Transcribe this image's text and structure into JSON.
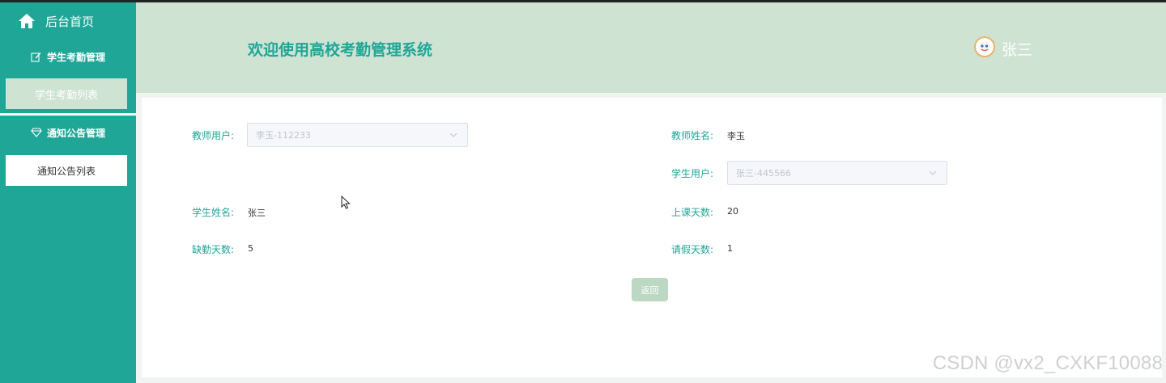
{
  "sidebar": {
    "home_label": "后台首页",
    "groups": [
      {
        "label": "学生考勤管理",
        "icon": "edit-icon"
      },
      {
        "label": "通知公告管理",
        "icon": "diamond-icon"
      }
    ],
    "items": [
      {
        "label": "学生考勤列表",
        "active": true
      },
      {
        "label": "通知公告列表",
        "active": false
      }
    ]
  },
  "header": {
    "title": "欢迎使用高校考勤管理系统",
    "username": "张三"
  },
  "form": {
    "teacher_user": {
      "label": "教师用户:",
      "value": "李玉-112233"
    },
    "teacher_name": {
      "label": "教师姓名:",
      "value": "李玉"
    },
    "student_user": {
      "label": "学生用户:",
      "value": "张三-445566"
    },
    "student_name": {
      "label": "学生姓名:",
      "value": "张三"
    },
    "class_days": {
      "label": "上课天数:",
      "value": "20"
    },
    "absent_days": {
      "label": "缺勤天数:",
      "value": "5"
    },
    "leave_days": {
      "label": "请假天数:",
      "value": "1"
    },
    "back_button": "返回"
  },
  "watermark": "CSDN @vx2_CXKF10088",
  "colors": {
    "accent": "#1fa697",
    "header_bg": "#cfe3d3",
    "button_bg": "#bcd7c2"
  }
}
